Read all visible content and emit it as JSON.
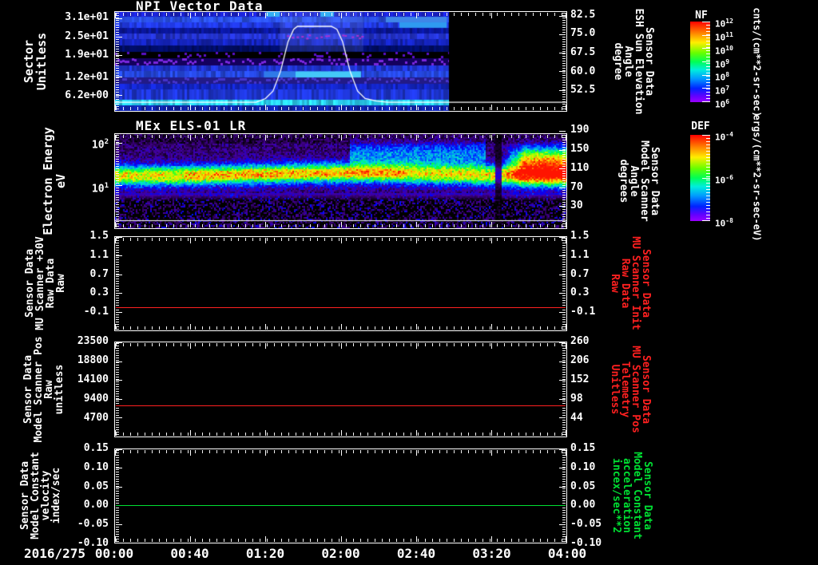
{
  "figure": {
    "date_label": "2016/275",
    "background": "#000000",
    "foreground": "#ffffff",
    "x_axis": {
      "ticks": [
        "00:00",
        "00:40",
        "01:20",
        "02:00",
        "02:40",
        "03:20",
        "04:00"
      ],
      "start_minutes": 0,
      "end_minutes": 240
    }
  },
  "colorbars": [
    {
      "id": "NF",
      "title": "NF",
      "ticks": [
        "10^12",
        "10^11",
        "10^10",
        "10^9",
        "10^8",
        "10^7",
        "10^6"
      ],
      "unit": "cnts/(cm**2-sr-sec)"
    },
    {
      "id": "DEF",
      "title": "DEF",
      "ticks": [
        "10^-4",
        "10^-6",
        "10^-8"
      ],
      "unit": "ergs/(cm**2-sr-sec-eV)"
    }
  ],
  "chart_data": [
    {
      "id": "npi-vector-data",
      "type": "heatmap",
      "title": "NPI Vector Data",
      "left_label_lines": [
        "Sector",
        "Unitless"
      ],
      "left_ticks": [
        "3.1e+01",
        "2.5e+01",
        "1.9e+01",
        "1.2e+01",
        "6.2e+00"
      ],
      "left_y_range": [
        33,
        1
      ],
      "right_label_lines": [
        "Sensor Data",
        "ESH Sun Elevation",
        "Angle",
        "degree"
      ],
      "right_label_color": "#ffffff",
      "right_ticks": [
        "82.5",
        "75.0",
        "67.5",
        "60.0",
        "52.5"
      ],
      "right_y_range": [
        84,
        44
      ],
      "colorbar": "NF",
      "data_end_frac": 0.74,
      "overlay_line": {
        "name": "esh-sun-elevation-curve",
        "color": "#ffffff",
        "points_minutes_degrees": [
          [
            0,
            47.5
          ],
          [
            75,
            47.5
          ],
          [
            80,
            49
          ],
          [
            84,
            52
          ],
          [
            88,
            60
          ],
          [
            92,
            72
          ],
          [
            95,
            77
          ],
          [
            97,
            78.2
          ],
          [
            115,
            78.2
          ],
          [
            118,
            77
          ],
          [
            121,
            72
          ],
          [
            125,
            60
          ],
          [
            129,
            52
          ],
          [
            133,
            49
          ],
          [
            139,
            48
          ],
          [
            145,
            47.5
          ],
          [
            240,
            47.5
          ]
        ]
      },
      "hump": {
        "x0": 0.365,
        "x1": 0.55
      },
      "bands": [
        {
          "f0": 0.0,
          "f1": 0.048,
          "color": "#1a22cc",
          "mode": "solid"
        },
        {
          "f0": 0.048,
          "f1": 0.105,
          "color": "#2a50e8",
          "mode": "solid"
        },
        {
          "f0": 0.105,
          "f1": 0.16,
          "color": "#2038dd",
          "mode": "solid"
        },
        {
          "f0": 0.16,
          "f1": 0.215,
          "color": "#0a1699",
          "mode": "solid"
        },
        {
          "f0": 0.215,
          "f1": 0.272,
          "color": "#2433cc",
          "mode": "solid"
        },
        {
          "f0": 0.272,
          "f1": 0.335,
          "color": "#1423b8",
          "mode": "solid"
        },
        {
          "f0": 0.335,
          "f1": 0.4,
          "color": "#000d66",
          "mode": "solid"
        },
        {
          "f0": 0.4,
          "f1": 0.465,
          "color": "#000000",
          "mode": "speckle",
          "speckle": "#5a10c8",
          "base": "#000000"
        },
        {
          "f0": 0.465,
          "f1": 0.54,
          "color": "#14005e",
          "mode": "speckle-dense",
          "speckle": "#7a26dd",
          "base": "#14005e"
        },
        {
          "f0": 0.54,
          "f1": 0.6,
          "color": "#1f33cc",
          "mode": "solid"
        },
        {
          "f0": 0.6,
          "f1": 0.662,
          "color": "#2547dd",
          "mode": "solid"
        },
        {
          "f0": 0.662,
          "f1": 0.725,
          "color": "#2a22a8",
          "mode": "speckle-dense",
          "speckle": "#4433cc",
          "base": "#221a88"
        },
        {
          "f0": 0.725,
          "f1": 0.785,
          "color": "#1325c4",
          "mode": "solid"
        },
        {
          "f0": 0.785,
          "f1": 0.885,
          "color": "#1e35d0",
          "mode": "solid"
        },
        {
          "f0": 0.885,
          "f1": 0.945,
          "color": "#2bd2f5",
          "mode": "solid"
        },
        {
          "f0": 0.945,
          "f1": 1.0,
          "color": "#0f23a8",
          "mode": "solid"
        }
      ],
      "segments": [
        {
          "x0": 0.4,
          "x1": 0.545,
          "f0": 0.6,
          "f1": 0.662,
          "color": "#44c8f8"
        },
        {
          "x0": 0.33,
          "x1": 0.4,
          "f0": 0.6,
          "f1": 0.662,
          "color": "#2f7ae8"
        },
        {
          "x0": 0.63,
          "x1": 0.735,
          "f0": 0.105,
          "f1": 0.16,
          "color": "#2f9af0"
        },
        {
          "x0": 0.6,
          "x1": 0.735,
          "f0": 0.048,
          "f1": 0.105,
          "color": "#3f86e8"
        },
        {
          "x0": 0.335,
          "x1": 0.365,
          "f0": 0.0,
          "f1": 0.048,
          "color": "#34aef2"
        },
        {
          "x0": 0.455,
          "x1": 0.485,
          "f0": 0.0,
          "f1": 0.048,
          "color": "#34aef2"
        }
      ]
    },
    {
      "id": "mex-els-01-lr",
      "type": "spectrogram",
      "title": "MEx ELS-01 LR",
      "left_label_lines": [
        "Electron Energy",
        "eV"
      ],
      "left_ticks": [
        "10^2",
        "10^1"
      ],
      "left_y_range": [
        160,
        1
      ],
      "left_log": true,
      "right_label_lines": [
        "Sensor Data",
        "Model Scanner",
        "Angle",
        "degrees"
      ],
      "right_label_color": "#ffffff",
      "right_ticks": [
        "190",
        "150",
        "110",
        "70",
        "30"
      ],
      "right_y_range": [
        184,
        -18
      ],
      "colorbar": "DEF",
      "features": {
        "band_center_frac": 0.42,
        "band_sigma": 0.075,
        "band_amp": 0.66,
        "diffuse_x0": 0.52,
        "diffuse_x1": 0.82,
        "diffuse_center_frac": 0.2,
        "red_blob_x0": 0.853,
        "red_center_frac": 0.27,
        "seam_x0": 0.842,
        "seam_x1": 0.855,
        "white_line_frac": 0.917,
        "speckle_zone_frac": 0.62
      }
    },
    {
      "id": "mu-scanner-30v",
      "type": "line",
      "left_label_lines": [
        "Sensor Data",
        "MU Scanner +30V",
        "Raw Data",
        "Raw"
      ],
      "left_label_color": "#ffffff",
      "left_ticks": [
        "1.5",
        "1.1",
        "0.7",
        "0.3",
        "-0.1"
      ],
      "left_y_range": [
        1.5,
        -0.5
      ],
      "right_ticks": [
        "1.5",
        "1.1",
        "0.7",
        "0.3",
        "-0.1"
      ],
      "right_y_range": [
        1.5,
        -0.5
      ],
      "right_label_lines": [
        "Sensor Data",
        "MU Scanner Init",
        "Raw Data",
        "Raw"
      ],
      "right_label_color": "#ff2020",
      "series": [
        {
          "name": "mu-scanner-30v-raw",
          "color": "#ff2020",
          "constant_value": 0.0
        }
      ]
    },
    {
      "id": "model-scanner-pos",
      "type": "line",
      "left_label_lines": [
        "Sensor Data",
        "Model Scanner Pos",
        "Raw",
        "unitless"
      ],
      "left_label_color": "#ffffff",
      "left_ticks": [
        "23500",
        "18800",
        "14100",
        "9400",
        "4700"
      ],
      "left_y_range": [
        23500,
        0
      ],
      "right_ticks": [
        "260",
        "206",
        "152",
        "98",
        "44"
      ],
      "right_y_range": [
        260,
        -10
      ],
      "right_label_lines": [
        "Sensor Data",
        "MU Scanner Pos",
        "Telemetry",
        "Unitless"
      ],
      "right_label_color": "#ff2020",
      "series": [
        {
          "name": "model-scanner-pos-raw",
          "color": "#ff2020",
          "constant_value": 7800
        }
      ]
    },
    {
      "id": "model-constant-velocity",
      "type": "line",
      "left_label_lines": [
        "Sensor Data",
        "Model Constant",
        "velocity",
        "index/sec"
      ],
      "left_label_color": "#ffffff",
      "left_ticks": [
        "0.15",
        "0.10",
        "0.05",
        "0.00",
        "-0.05",
        "-0.10"
      ],
      "left_y_range": [
        0.15,
        -0.1
      ],
      "right_ticks": [
        "0.15",
        "0.10",
        "0.05",
        "0.00",
        "-0.05",
        "-0.10"
      ],
      "right_y_range": [
        0.15,
        -0.1
      ],
      "right_label_lines": [
        "Sensor Data",
        "Model Constant",
        "acceleration",
        "incex/sec**2"
      ],
      "right_label_color": "#00e033",
      "series": [
        {
          "name": "model-constant-velocity",
          "color": "#00e033",
          "constant_value": 0.0
        }
      ]
    }
  ]
}
